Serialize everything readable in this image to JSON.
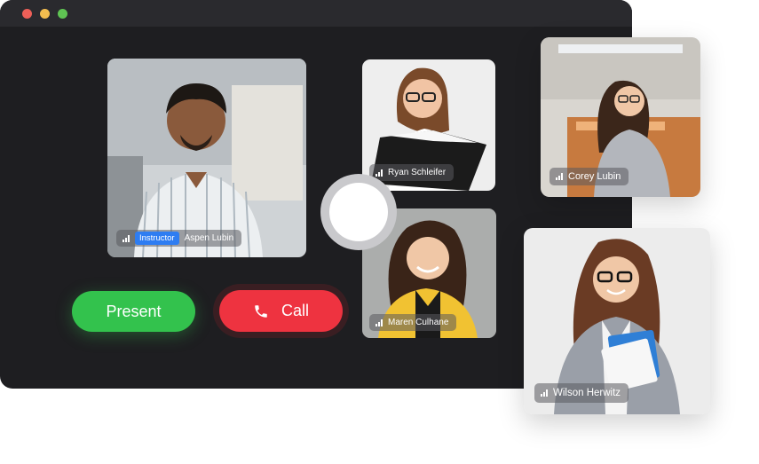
{
  "window": {
    "controls": [
      "close",
      "minimize",
      "maximize"
    ]
  },
  "participants": {
    "host": {
      "name": "Aspen Lubin",
      "role_badge": "Instructor"
    },
    "p2": {
      "name": "Ryan Schleifer"
    },
    "p3": {
      "name": "Maren Culhane"
    },
    "p4": {
      "name": "Corey Lubin"
    },
    "p5": {
      "name": "Wilson Herwitz"
    }
  },
  "controls": {
    "present_label": "Present",
    "call_label": "Call"
  },
  "icons": {
    "signal": "signal-bars-icon",
    "phone": "phone-icon"
  },
  "colors": {
    "present": "#33c24d",
    "call": "#ee3340",
    "badge": "#2e7df2",
    "window_bg": "#1e1e21"
  }
}
